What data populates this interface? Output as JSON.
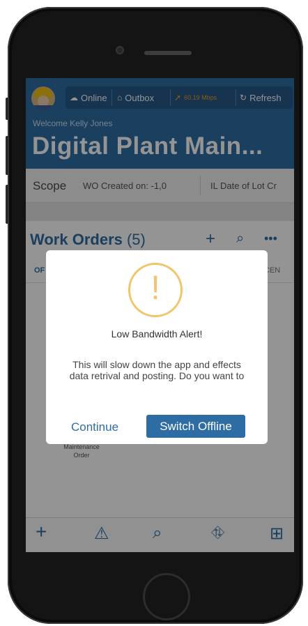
{
  "status": {
    "online_label": "Online",
    "outbox_label": "Outbox",
    "speed_text": "60.19 Mbps",
    "refresh_label": "Refresh"
  },
  "header": {
    "welcome_prefix": "Welcome",
    "user_name": "Kelly Jones",
    "app_title": "Digital Plant Main..."
  },
  "scope": {
    "label": "Scope",
    "filters": [
      "WO Created on: -1,0",
      "IL Date of Lot Cr"
    ]
  },
  "work_orders": {
    "title": "Work Orders",
    "count": "(5)",
    "tab_left": "OF",
    "tab_right": "CEN",
    "item_label_line1": "Maintenance",
    "item_label_line2": "Order"
  },
  "bottom_nav": {
    "icons": [
      "plus-icon",
      "warning-icon",
      "search-icon",
      "map-icon",
      "grid-icon"
    ]
  },
  "modal": {
    "icon": "exclamation-icon",
    "title": "Low Bandwidth Alert!",
    "body": "This will slow down the app and effects data retrival and posting. Do you want to",
    "continue_label": "Continue",
    "switch_offline_label": "Switch Offline"
  },
  "colors": {
    "primary": "#2e6da4",
    "alert": "#f0c56b",
    "speed": "#e7a21e"
  }
}
